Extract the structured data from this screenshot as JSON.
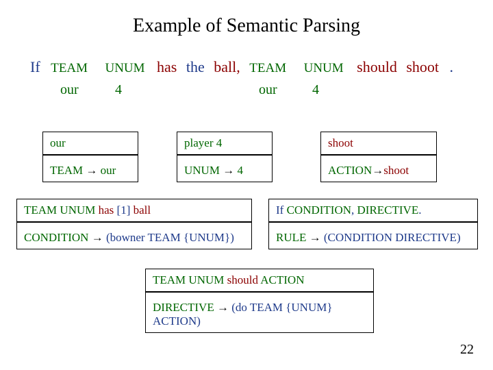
{
  "title": "Example of Semantic Parsing",
  "tokens": {
    "if": "If",
    "team1": "TEAM",
    "unum1": "UNUM",
    "has": "has",
    "the": "the",
    "ball": "ball,",
    "team2": "TEAM",
    "unum2": "UNUM",
    "should": "should",
    "shoot": "shoot",
    "period": "."
  },
  "values": {
    "our1": "our",
    "four1": "4",
    "our2": "our",
    "four2": "4"
  },
  "box_our": {
    "top": "our",
    "bot_left": "TEAM ",
    "bot_arrow": "→",
    "bot_right": " our"
  },
  "box_player4": {
    "top": "player 4",
    "bot_left": "UNUM ",
    "bot_arrow": "→",
    "bot_right": " 4"
  },
  "box_shoot": {
    "top": "shoot",
    "bot_left": "ACTION",
    "bot_arrow": "→",
    "bot_right": "shoot"
  },
  "box_cond": {
    "top_a": "TEAM UNUM ",
    "top_b": "has",
    "top_c": " [1] ",
    "top_d": "ball",
    "bot_a": "CONDITION ",
    "bot_arrow": "→",
    "bot_b": " (bowner TEAM {UNUM})"
  },
  "box_rule": {
    "top_a": "If ",
    "top_b": "CONDITION",
    "top_c": ", ",
    "top_d": "DIRECTIVE",
    "top_e": ".",
    "bot_a": "RULE ",
    "bot_arrow": "→",
    "bot_b": " (CONDITION DIRECTIVE)"
  },
  "box_dir": {
    "top_a": "TEAM UNUM ",
    "top_b": "should",
    "top_c": " ACTION",
    "bot_a": "DIRECTIVE ",
    "bot_arrow": "→",
    "bot_b": " (do TEAM {UNUM} ACTION)"
  },
  "pagenum": "22"
}
